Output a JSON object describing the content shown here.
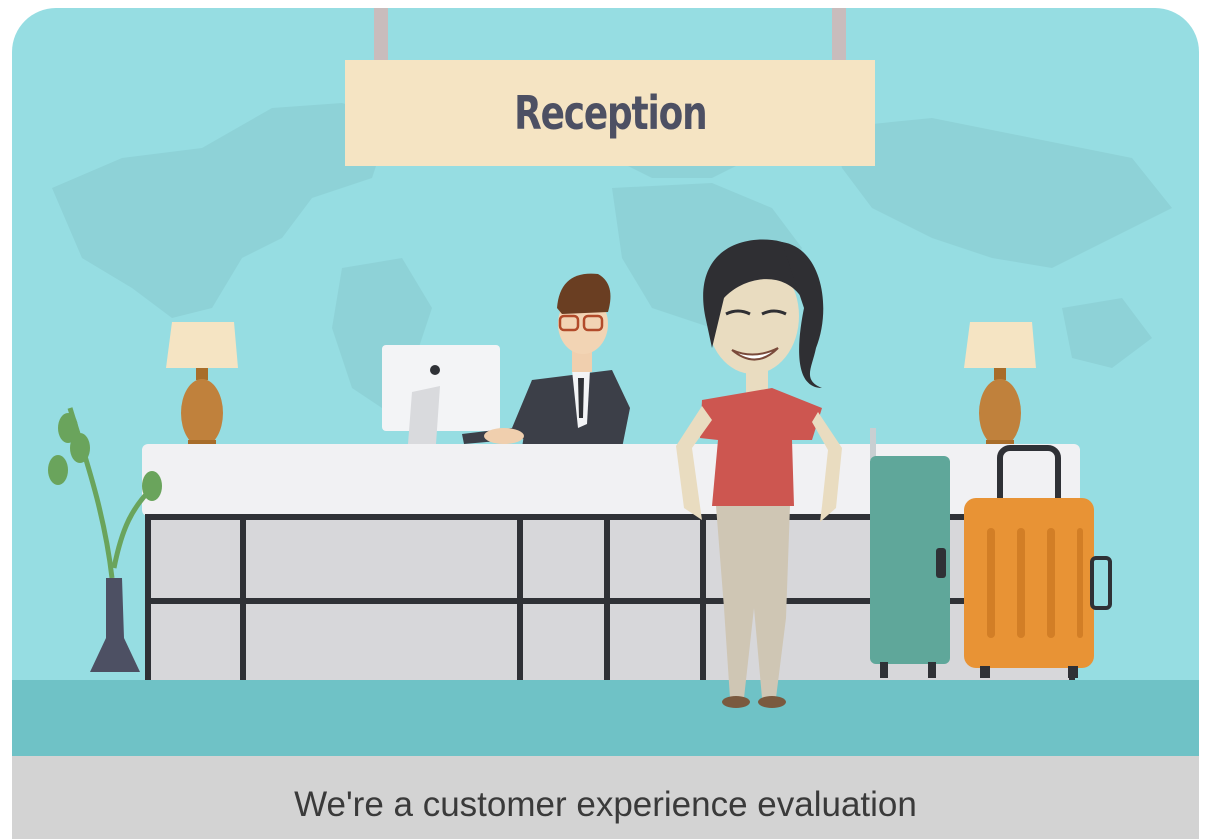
{
  "sign": {
    "label": "Reception"
  },
  "caption": {
    "text": "We're a customer experience evaluation"
  },
  "colors": {
    "sky": "#96dde2",
    "floor": "#6fc2c6",
    "sign_board": "#f5e4c3",
    "desk_top": "#f1f1f3",
    "desk_panel": "#d7d7da",
    "desk_frame": "#2f3136",
    "suitcase_green": "#5fa79a",
    "suitcase_orange": "#e89335",
    "caption_bar": "#d3d3d3"
  }
}
